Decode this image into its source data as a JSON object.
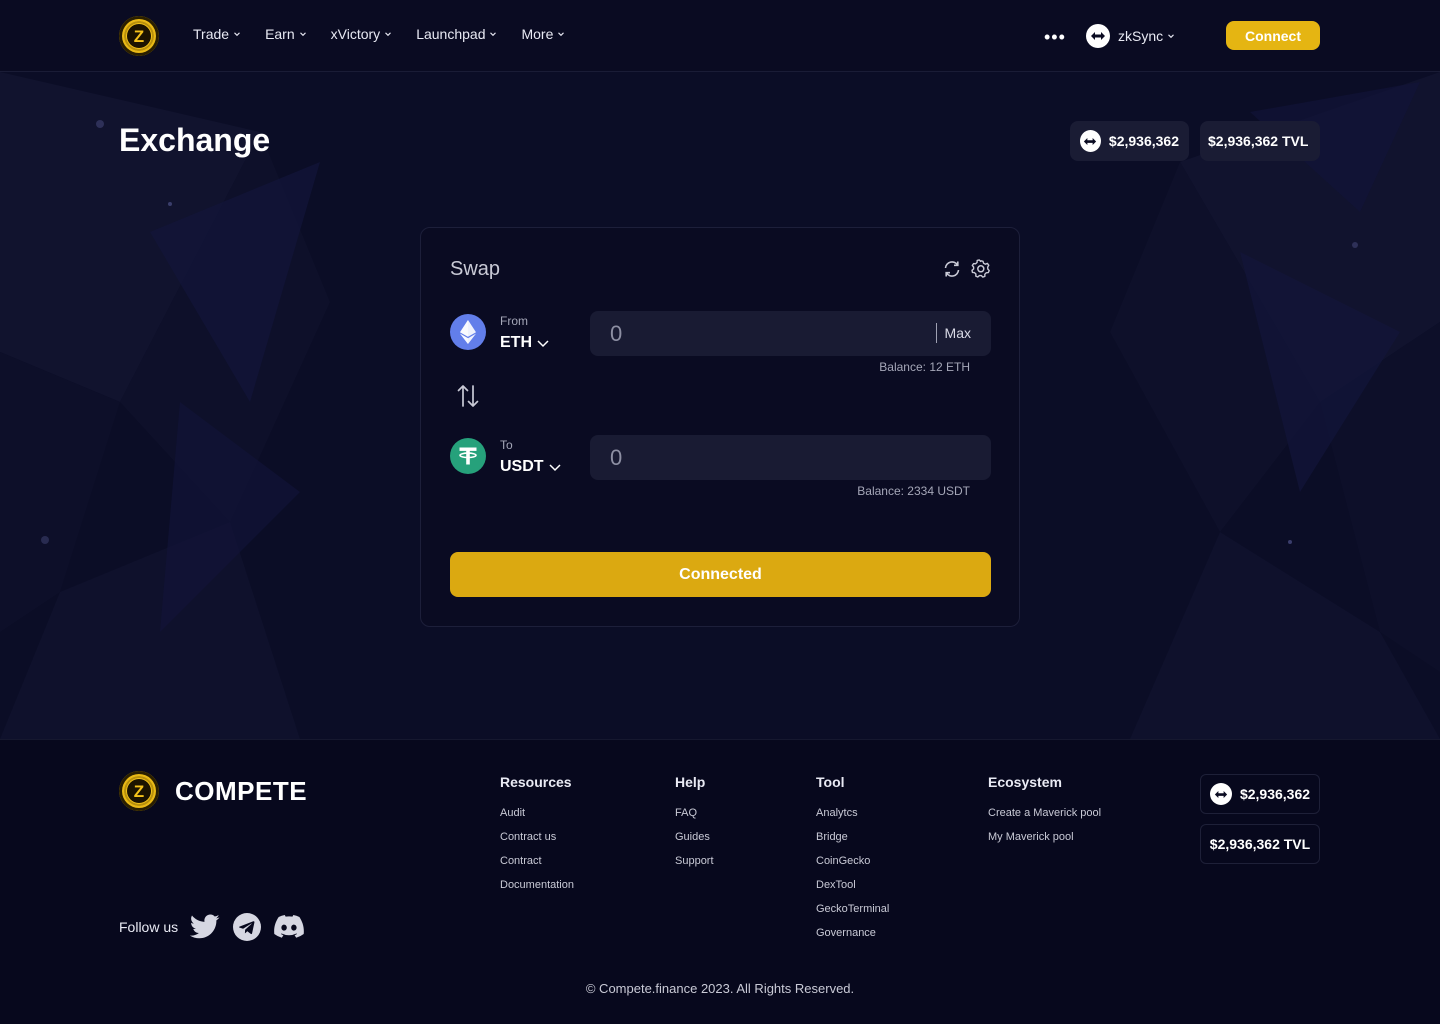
{
  "header": {
    "nav": [
      {
        "label": "Trade"
      },
      {
        "label": "Earn"
      },
      {
        "label": "xVictory"
      },
      {
        "label": "Launchpad"
      },
      {
        "label": "More"
      }
    ],
    "more_dots": "•••",
    "network": "zkSync",
    "connect_label": "Connect"
  },
  "page": {
    "title": "Exchange",
    "price": "$2,936,362",
    "tvl": "$2,936,362 TVL"
  },
  "swap": {
    "title": "Swap",
    "from": {
      "label": "From",
      "symbol": "ETH",
      "value": "0",
      "max_label": "Max",
      "balance": "Balance: 12 ETH"
    },
    "to": {
      "label": "To",
      "symbol": "USDT",
      "value": "0",
      "balance": "Balance: 2334 USDT"
    },
    "action_label": "Connected"
  },
  "footer": {
    "brand": "COMPETE",
    "columns": [
      {
        "title": "Resources",
        "links": [
          "Audit",
          "Contract us",
          "Contract",
          "Documentation"
        ]
      },
      {
        "title": "Help",
        "links": [
          "FAQ",
          "Guides",
          "Support"
        ]
      },
      {
        "title": "Tool",
        "links": [
          "Analytcs",
          "Bridge",
          "CoinGecko",
          "DexTool",
          "GeckoTerminal",
          "Governance"
        ]
      },
      {
        "title": "Ecosystem",
        "links": [
          "Create a Maverick pool",
          "My Maverick pool"
        ]
      }
    ],
    "follow_label": "Follow us",
    "price": "$2,936,362",
    "tvl": "$2,936,362 TVL",
    "copyright": "© Compete.finance 2023. All Rights Reserved."
  },
  "colors": {
    "accent": "#e5b512",
    "background": "#0a0b22",
    "eth": "#627eea",
    "usdt": "#26a17b"
  }
}
